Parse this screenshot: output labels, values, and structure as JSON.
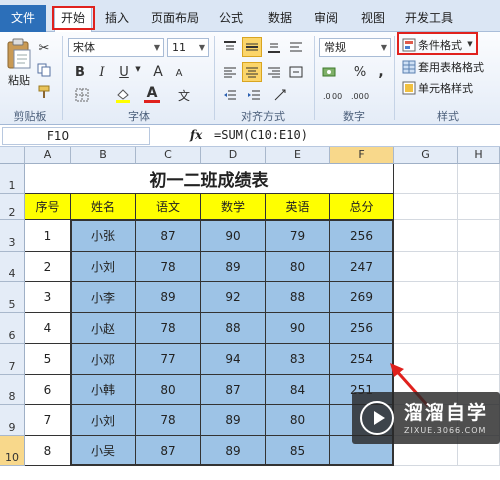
{
  "ribbon_tabs": [
    "文件",
    "开始",
    "插入",
    "页面布局",
    "公式",
    "数据",
    "审阅",
    "视图",
    "开发工具"
  ],
  "clipboard": {
    "paste": "粘贴",
    "group": "剪贴板"
  },
  "font": {
    "name": "宋体",
    "size": "11",
    "bold": "B",
    "italic": "I",
    "underline": "U",
    "grow": "A",
    "shrink": "A",
    "font_color": "A",
    "wen": "文",
    "group": "字体"
  },
  "alignment": {
    "group": "对齐方式"
  },
  "number": {
    "format": "常规",
    "percent": "%",
    "comma": ",",
    "group": "数字"
  },
  "styles": {
    "conditional": "条件格式",
    "table_format": "套用表格格式",
    "cell_styles": "单元格样式",
    "group": "样式"
  },
  "formula_bar": {
    "name_box": "F10",
    "fx": "fx",
    "formula": "=SUM(C10:E10)"
  },
  "columns": [
    "A",
    "B",
    "C",
    "D",
    "E",
    "F",
    "G",
    "H"
  ],
  "rows": [
    "1",
    "2",
    "3",
    "4",
    "5",
    "6",
    "7",
    "8",
    "9",
    "10"
  ],
  "sheet": {
    "title": "初一二班成绩表",
    "headers": [
      "序号",
      "姓名",
      "语文",
      "数学",
      "英语",
      "总分"
    ],
    "data": [
      [
        "1",
        "小张",
        "87",
        "90",
        "79",
        "256"
      ],
      [
        "2",
        "小刘",
        "78",
        "89",
        "80",
        "247"
      ],
      [
        "3",
        "小李",
        "89",
        "92",
        "88",
        "269"
      ],
      [
        "4",
        "小赵",
        "78",
        "88",
        "90",
        "256"
      ],
      [
        "5",
        "小邓",
        "77",
        "94",
        "83",
        "254"
      ],
      [
        "6",
        "小韩",
        "80",
        "87",
        "84",
        "251"
      ],
      [
        "7",
        "小刘",
        "78",
        "89",
        "80",
        ""
      ],
      [
        "8",
        "小吴",
        "87",
        "89",
        "85",
        ""
      ]
    ]
  },
  "watermark": {
    "text": "溜溜自学",
    "url": "ZIXUE.3066.COM"
  },
  "colors": {
    "highlight": "#e0211d",
    "header_fill": "#ffff00",
    "data_fill": "#9dc3e6"
  }
}
